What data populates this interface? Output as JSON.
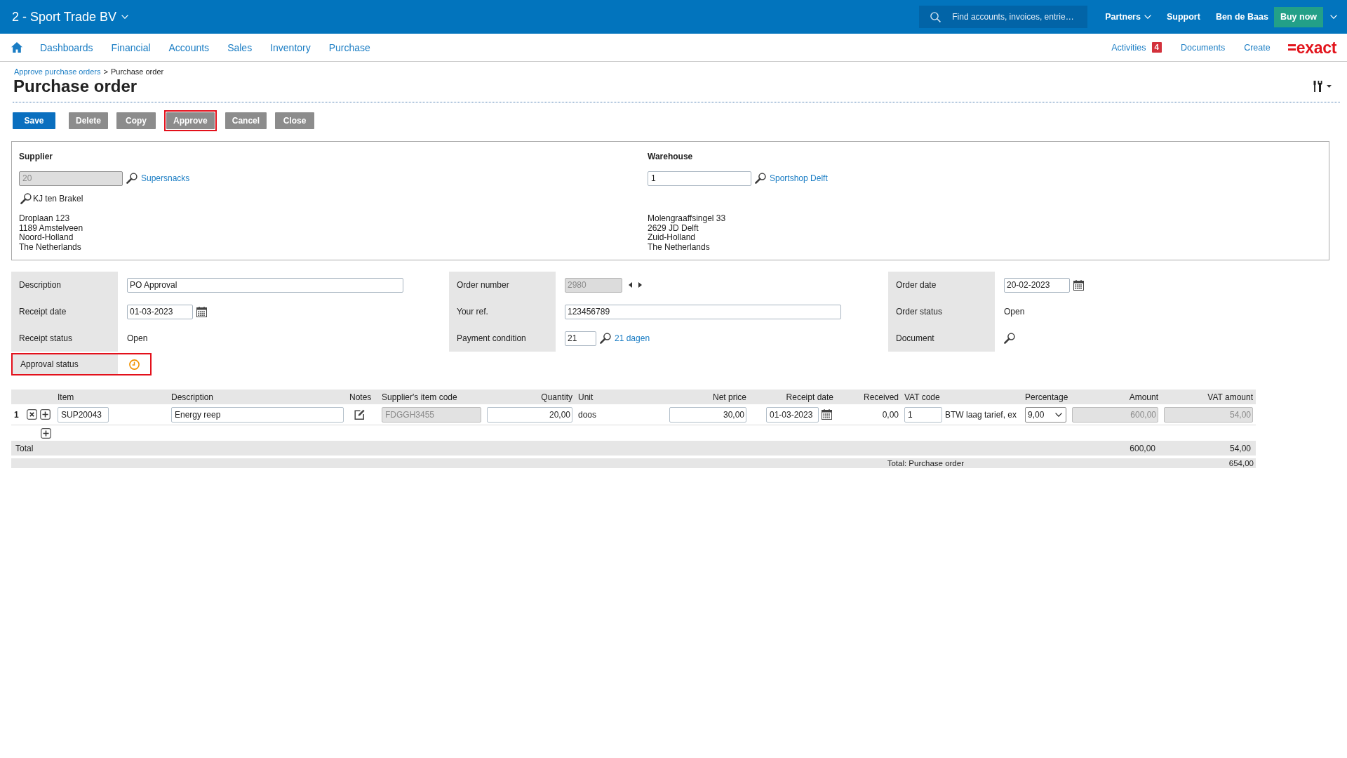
{
  "header": {
    "company": "2 - Sport Trade BV",
    "search": {
      "placeholder": "Find accounts, invoices, entrie…"
    },
    "links": [
      {
        "label": "Partners",
        "dropdown": true
      },
      {
        "label": "Support",
        "dropdown": false
      },
      {
        "label": "Ben de Baas",
        "dropdown": false
      }
    ],
    "buy_button": "Buy now"
  },
  "nav": {
    "items": [
      "Dashboards",
      "Financial",
      "Accounts",
      "Sales",
      "Inventory",
      "Purchase"
    ],
    "actions": [
      {
        "label": "Activities",
        "badge": "4"
      },
      {
        "label": "Documents"
      },
      {
        "label": "Create"
      }
    ],
    "logo": "exact"
  },
  "breadcrumb": {
    "items": [
      {
        "label": "Approve purchase orders",
        "kind": "link"
      },
      {
        "label": "Purchase order",
        "kind": "current"
      }
    ],
    "separator": ">"
  },
  "page_title": "Purchase order",
  "toolbar": {
    "buttons": [
      {
        "label": "Save",
        "kind": "primary",
        "highlighted": false
      },
      {
        "label": "Delete",
        "kind": "secondary",
        "highlighted": false
      },
      {
        "label": "Copy",
        "kind": "secondary",
        "highlighted": false
      },
      {
        "label": "Approve",
        "kind": "secondary",
        "highlighted": true
      },
      {
        "label": "Cancel",
        "kind": "secondary",
        "highlighted": false
      },
      {
        "label": "Close",
        "kind": "secondary",
        "highlighted": false
      }
    ]
  },
  "parties": [
    {
      "heading": "Supplier",
      "code": {
        "value": "20",
        "disabled": true
      },
      "name": "Supersnacks",
      "contact": "KJ ten Brakel",
      "address": [
        "Droplaan 123",
        "1189 Amstelveen",
        "Noord-Holland",
        "The Netherlands"
      ]
    },
    {
      "heading": "Warehouse",
      "code": {
        "value": "1",
        "disabled": false
      },
      "name": "Sportshop Delft",
      "address": [
        "Molengraaffsingel 33",
        "2629 JD Delft",
        "Zuid-Holland",
        "The Netherlands"
      ]
    }
  ],
  "details": {
    "columns": [
      [
        {
          "label": "Description",
          "kind": "input",
          "value": "PO Approval",
          "highlighted": false
        },
        {
          "label": "Receipt date",
          "kind": "date",
          "value": "01-03-2023",
          "highlighted": false
        },
        {
          "label": "Receipt status",
          "kind": "text",
          "value": "Open",
          "highlighted": false
        },
        {
          "label": "Approval status",
          "kind": "status",
          "highlighted": true
        }
      ],
      [
        {
          "label": "Order number",
          "kind": "stepper",
          "value": "2980",
          "disabled": true,
          "highlighted": false
        },
        {
          "label": "Your ref.",
          "kind": "input",
          "value": "123456789",
          "highlighted": false
        },
        {
          "label": "Payment condition",
          "kind": "lookup",
          "value": "21",
          "link": "21 dagen",
          "highlighted": false
        }
      ],
      [
        {
          "label": "Order date",
          "kind": "date",
          "value": "20-02-2023",
          "highlighted": false
        },
        {
          "label": "Order status",
          "kind": "text",
          "value": "Open",
          "highlighted": false
        },
        {
          "label": "Document",
          "kind": "search",
          "highlighted": false
        }
      ]
    ]
  },
  "lines": {
    "columns": [
      "Item",
      "Description",
      "Notes",
      "Supplier's item code",
      "Quantity",
      "Unit",
      "Net price",
      "Receipt date",
      "Received",
      "VAT code",
      "Percentage",
      "Amount",
      "VAT amount"
    ],
    "rows": [
      {
        "number": "1",
        "cells": [
          {
            "kind": "input",
            "value": "SUP20043",
            "disabled": false
          },
          {
            "kind": "input",
            "value": "Energy reep",
            "disabled": false
          },
          {
            "kind": "notes"
          },
          {
            "kind": "input",
            "value": "FDGGH3455",
            "disabled": true
          },
          {
            "kind": "input",
            "value": "20,00",
            "disabled": false
          },
          {
            "kind": "text",
            "value": "doos"
          },
          {
            "kind": "input",
            "value": "30,00",
            "disabled": false
          },
          {
            "kind": "date",
            "value": "01-03-2023"
          },
          {
            "kind": "text",
            "value": "0,00"
          },
          {
            "kind": "vat",
            "value": "1",
            "description": "BTW laag tarief, ex"
          },
          {
            "kind": "select",
            "value": "9,00"
          },
          {
            "kind": "input",
            "value": "600,00",
            "disabled": true
          },
          {
            "kind": "input",
            "value": "54,00",
            "disabled": true
          }
        ]
      }
    ],
    "total": {
      "label": "Total",
      "amount": "600,00",
      "vat_amount": "54,00"
    },
    "grand_total": {
      "label": "Total: Purchase order",
      "value": "654,00"
    }
  }
}
